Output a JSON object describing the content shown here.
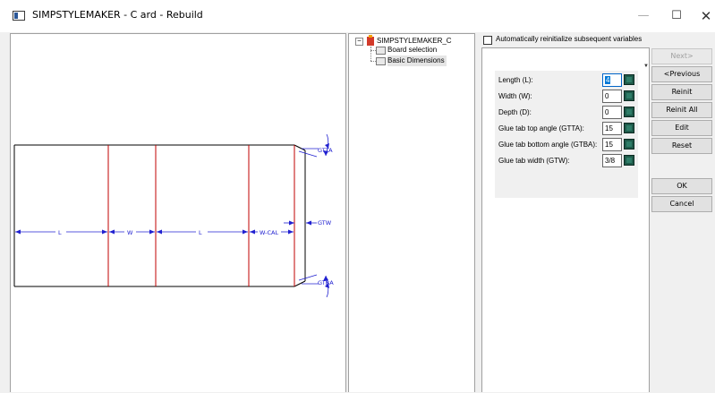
{
  "window": {
    "title": "SIMPSTYLEMAKER - C ard - Rebuild",
    "minimize": "—",
    "maximize": "☐",
    "close": "✕"
  },
  "drawing": {
    "line_color": "#2020d0",
    "panel_line_color": "#c00000",
    "labels": {
      "L1": "L",
      "W": "W",
      "L2": "L",
      "WCAL": "W-CAL",
      "GTW": "GTW",
      "GTTA": "GTTA",
      "GTBA": "GTBA"
    }
  },
  "tree": {
    "root": "SIMPSTYLEMAKER_C",
    "expander": "−",
    "children": [
      "Board selection",
      "Basic Dimensions"
    ],
    "selected_index": 1
  },
  "auto_reinit_label": "Automatically reinitialize subsequent variables",
  "auto_reinit_checked": false,
  "params": [
    {
      "label": "Length (L):",
      "value": "4",
      "focused": true
    },
    {
      "label": "Width (W):",
      "value": "0",
      "focused": false
    },
    {
      "label": "Depth (D):",
      "value": "0",
      "focused": false
    },
    {
      "label": "Glue tab top angle (GTTA):",
      "value": "15",
      "focused": false
    },
    {
      "label": "Glue tab bottom angle (GTBA):",
      "value": "15",
      "focused": false
    },
    {
      "label": "Glue tab width (GTW):",
      "value": "3/8",
      "focused": false
    }
  ],
  "buttons": {
    "next": "Next>",
    "previous": "<Previous",
    "reinit": "Reinit",
    "reinit_all": "Reinit All",
    "edit": "Edit",
    "reset": "Reset",
    "ok": "OK",
    "cancel": "Cancel"
  }
}
